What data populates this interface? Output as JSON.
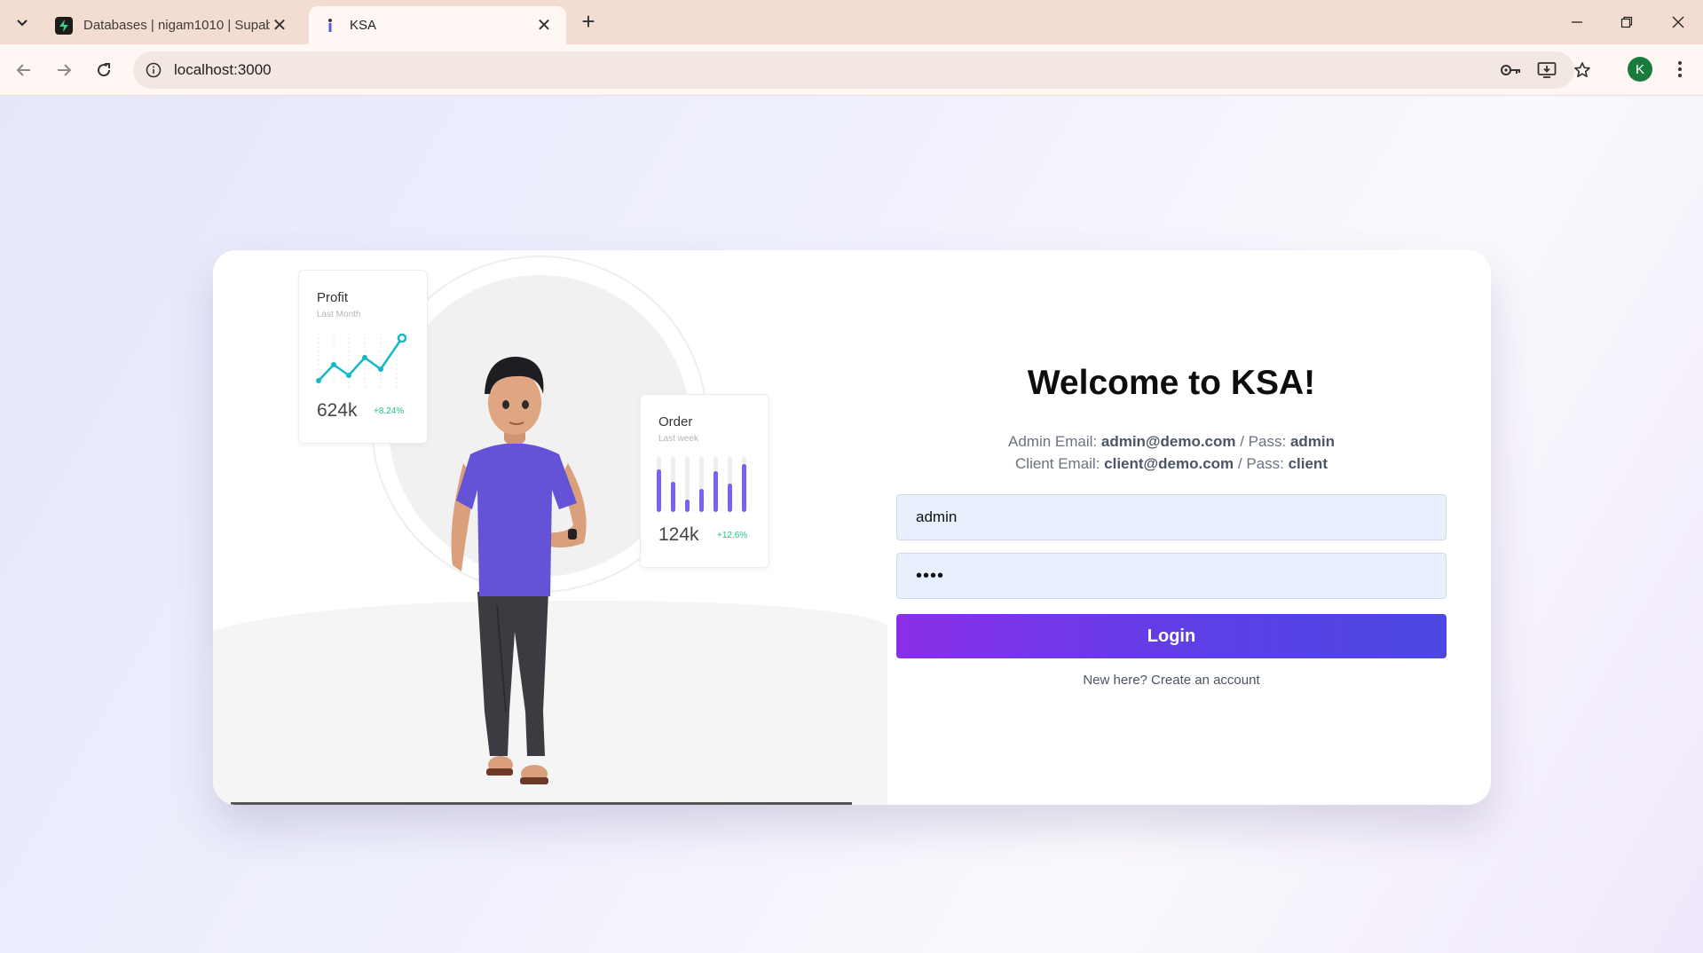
{
  "browser": {
    "tabs": [
      {
        "title": "Databases | nigam1010 | Supab",
        "active": false
      },
      {
        "title": "KSA",
        "active": true
      }
    ],
    "url": "localhost:3000",
    "profile_initial": "K"
  },
  "illustration": {
    "profit_card": {
      "title": "Profit",
      "subtitle": "Last Month",
      "value": "624k",
      "change": "+8.24%"
    },
    "order_card": {
      "title": "Order",
      "subtitle": "Last week",
      "value": "124k",
      "change": "+12.6%"
    }
  },
  "login": {
    "heading": "Welcome to KSA!",
    "admin_prefix": "Admin Email: ",
    "admin_email": "admin@demo.com",
    "admin_pass_prefix": " / Pass: ",
    "admin_pass": "admin",
    "client_prefix": "Client Email: ",
    "client_email": "client@demo.com",
    "client_pass_prefix": " / Pass: ",
    "client_pass": "client",
    "email_value": "admin",
    "password_value": "••••",
    "login_label": "Login",
    "signup_link": "New here? Create an account"
  },
  "colors": {
    "accent_start": "#8a2fe8",
    "accent_end": "#4c47e0",
    "input_bg": "#e8effd"
  }
}
